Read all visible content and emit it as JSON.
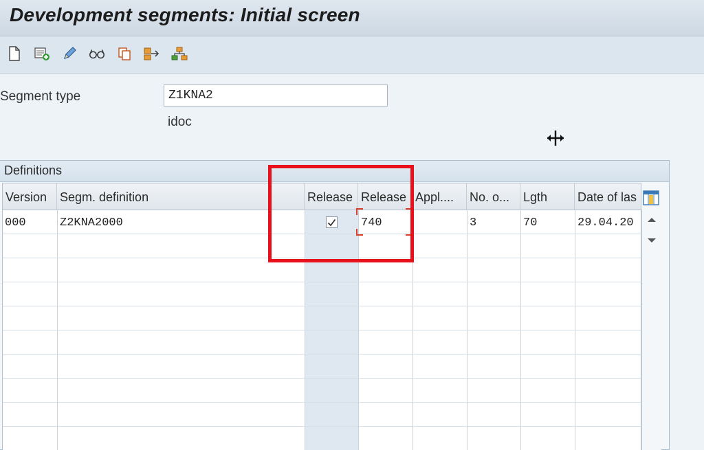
{
  "window": {
    "title": "Development segments: Initial screen"
  },
  "toolbar": {
    "buttons": [
      {
        "icon": "new-document-icon"
      },
      {
        "icon": "create-with-plus-icon"
      },
      {
        "icon": "pencil-edit-icon"
      },
      {
        "icon": "display-glasses-icon"
      },
      {
        "icon": "copy-icon"
      },
      {
        "icon": "transfer-arrow-icon"
      },
      {
        "icon": "hierarchy-tree-icon"
      }
    ]
  },
  "form": {
    "segment_type_label": "Segment type",
    "segment_type_value": "Z1KNA2",
    "description": "idoc"
  },
  "definitions": {
    "title": "Definitions",
    "columns": [
      "Version",
      "Segm. definition",
      "Release",
      "Release",
      "Appl....",
      "No. o...",
      "Lgth",
      "Date of las"
    ],
    "rows": [
      {
        "version": "000",
        "segm_definition": "Z2KNA2000",
        "released": true,
        "release": "740",
        "appl": "",
        "no_of": "3",
        "lgth": "70",
        "date": "29.04.20"
      }
    ]
  },
  "colors": {
    "highlight": "#e8101a",
    "title_bar": "#d6e0ea",
    "release_column_bg": "#dfe8f0"
  }
}
